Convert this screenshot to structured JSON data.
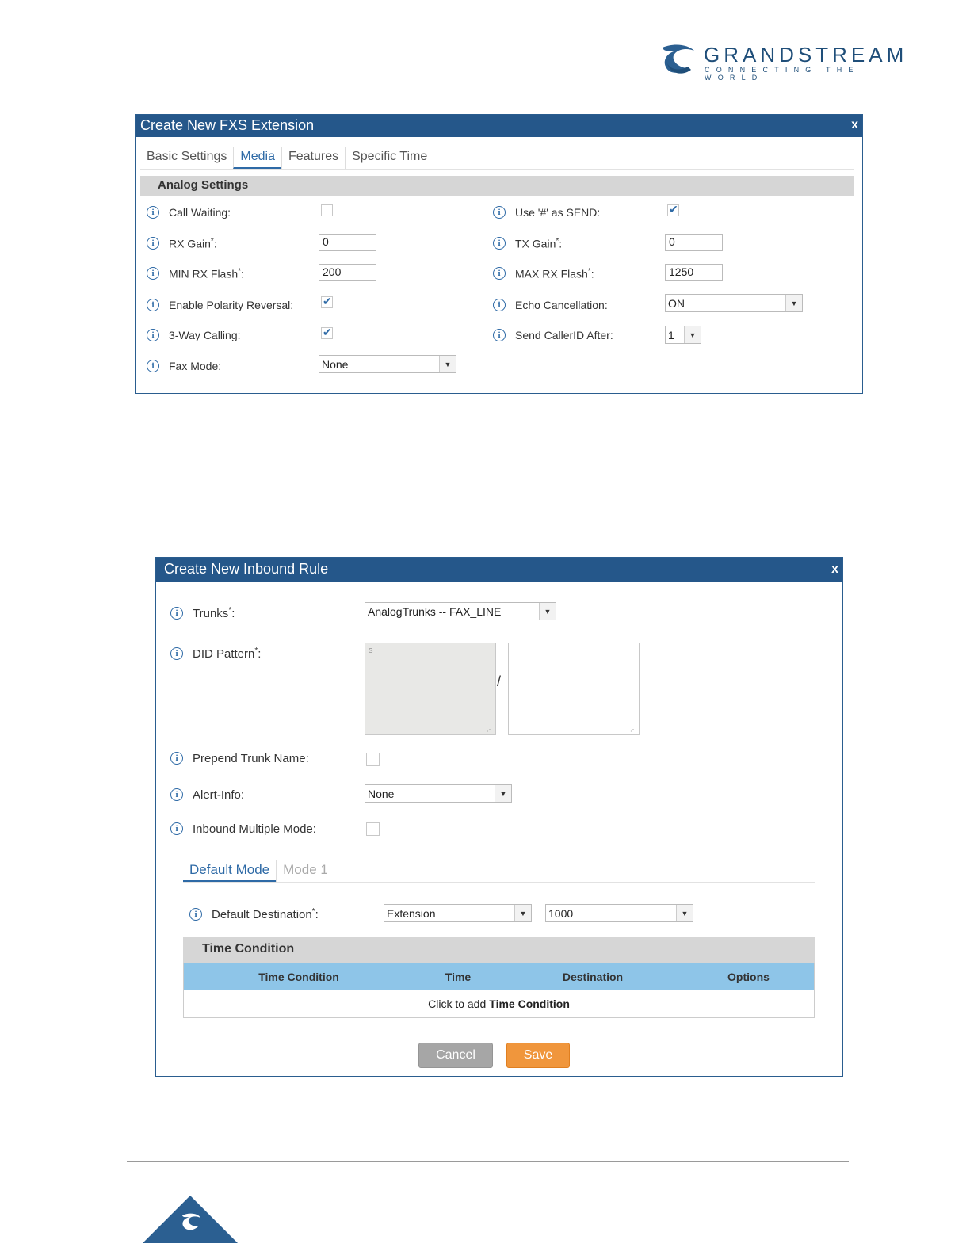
{
  "logo": {
    "name": "GRANDSTREAM",
    "tagline": "CONNECTING THE WORLD"
  },
  "fxs": {
    "title": "Create New FXS Extension",
    "close": "x",
    "tabs": [
      "Basic Settings",
      "Media",
      "Features",
      "Specific Time"
    ],
    "active_tab": "Media",
    "section": "Analog Settings",
    "fields": {
      "call_waiting": {
        "label": "Call Waiting:",
        "checked": false
      },
      "use_hash_send": {
        "label": "Use '#' as SEND:",
        "checked": true
      },
      "rx_gain": {
        "label": "RX Gain",
        "suffix": ":",
        "value": "0"
      },
      "tx_gain": {
        "label": "TX Gain",
        "suffix": ":",
        "value": "0"
      },
      "min_rx_flash": {
        "label": "MIN RX Flash",
        "suffix": ":",
        "value": "200"
      },
      "max_rx_flash": {
        "label": "MAX RX Flash",
        "suffix": ":",
        "value": "1250"
      },
      "polarity_reversal": {
        "label": "Enable Polarity Reversal:",
        "checked": true
      },
      "echo_cancellation": {
        "label": "Echo Cancellation:",
        "value": "ON"
      },
      "three_way": {
        "label": "3-Way Calling:",
        "checked": true
      },
      "send_callerid_after": {
        "label": "Send CallerID After:",
        "value": "1"
      },
      "fax_mode": {
        "label": "Fax Mode:",
        "value": "None"
      }
    },
    "required_mark": "*"
  },
  "inbound": {
    "title": "Create New Inbound Rule",
    "close": "x",
    "trunks": {
      "label": "Trunks",
      "suffix": ":",
      "value": "AnalogTrunks -- FAX_LINE"
    },
    "did_pattern": {
      "label": "DID Pattern",
      "suffix": ":",
      "left_value": "s",
      "separator": "/",
      "right_value": ""
    },
    "prepend_trunk_name": {
      "label": "Prepend Trunk Name:",
      "checked": false
    },
    "alert_info": {
      "label": "Alert-Info:",
      "value": "None"
    },
    "inbound_multiple_mode": {
      "label": "Inbound Multiple Mode:",
      "checked": false
    },
    "mode_tabs": [
      "Default Mode",
      "Mode 1"
    ],
    "default_destination": {
      "label": "Default Destination",
      "suffix": ":",
      "type_value": "Extension",
      "target_value": "1000"
    },
    "time_condition": {
      "section": "Time Condition",
      "columns": [
        "Time Condition",
        "Time",
        "Destination",
        "Options"
      ],
      "empty_prefix": "Click to add",
      "empty_link": "Time Condition"
    },
    "buttons": {
      "cancel": "Cancel",
      "save": "Save"
    }
  },
  "colors": {
    "header": "#25578a",
    "accent": "#2e6aa6",
    "save": "#f0963c",
    "table_head": "#8ec5e8"
  }
}
